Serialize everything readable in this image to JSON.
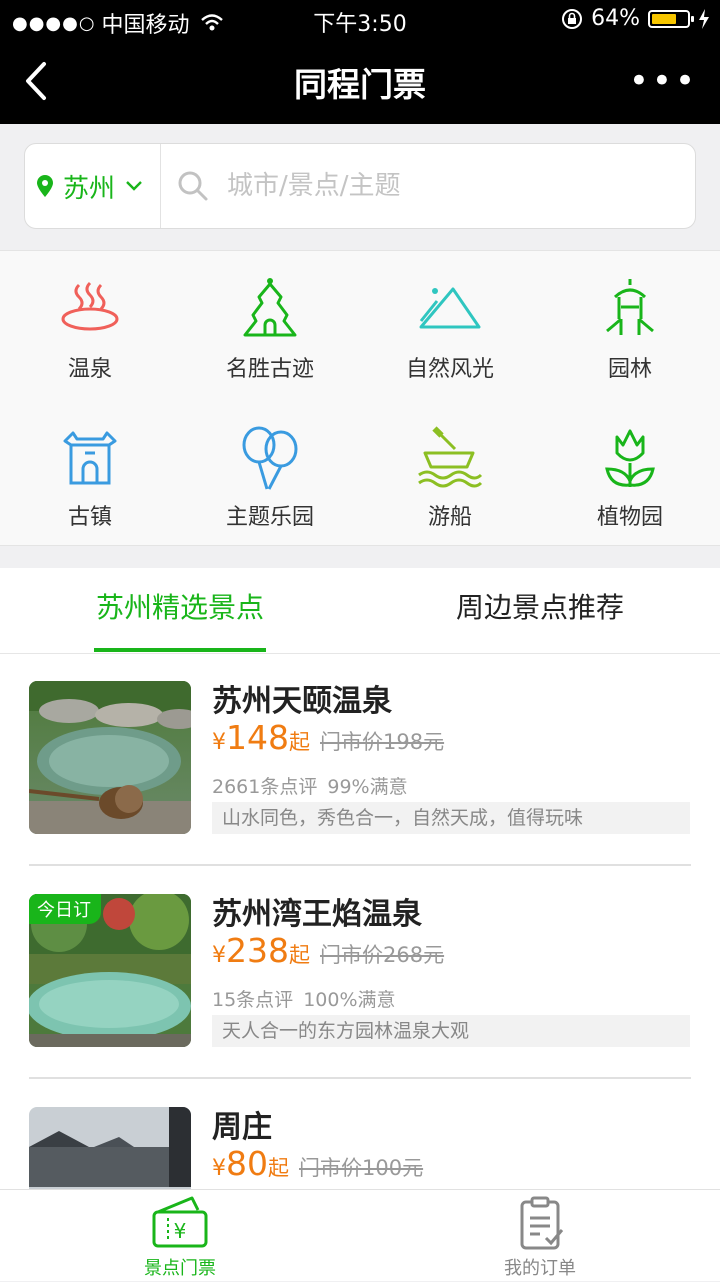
{
  "status_bar": {
    "signal": "●●●●○",
    "carrier": "中国移动",
    "time": "下午3:50",
    "battery": "64%",
    "battery_level": 0.64
  },
  "nav": {
    "title": "同程门票",
    "more": "•••"
  },
  "search": {
    "city": "苏州",
    "placeholder": "城市/景点/主题"
  },
  "categories": [
    {
      "label": "温泉",
      "icon": "hot-spring-icon",
      "color": "#f0605a"
    },
    {
      "label": "名胜古迹",
      "icon": "pagoda-icon",
      "color": "#19b51a"
    },
    {
      "label": "自然风光",
      "icon": "mountain-icon",
      "color": "#2fc6c0"
    },
    {
      "label": "园林",
      "icon": "pavilion-icon",
      "color": "#19b51a"
    },
    {
      "label": "古镇",
      "icon": "town-gate-icon",
      "color": "#3a9be0"
    },
    {
      "label": "主题乐园",
      "icon": "balloon-icon",
      "color": "#3a9be0"
    },
    {
      "label": "游船",
      "icon": "boat-icon",
      "color": "#8cbf23"
    },
    {
      "label": "植物园",
      "icon": "flower-icon",
      "color": "#19b51a"
    }
  ],
  "tabs": [
    {
      "label": "苏州精选景点",
      "active": true
    },
    {
      "label": "周边景点推荐",
      "active": false
    }
  ],
  "items": [
    {
      "name": "苏州天颐温泉",
      "yen": "¥",
      "price": "148",
      "qi": "起",
      "market": "门市价198元",
      "reviews": "2661条点评",
      "satisfaction": "99%满意",
      "desc": "山水同色，秀色合一，自然天成，值得玩味",
      "badge": ""
    },
    {
      "name": "苏州湾王焰温泉",
      "yen": "¥",
      "price": "238",
      "qi": "起",
      "market": "门市价268元",
      "reviews": "15条点评",
      "satisfaction": "100%满意",
      "desc": "天人合一的东方园林温泉大观",
      "badge": "今日订"
    },
    {
      "name": "周庄",
      "yen": "¥",
      "price": "80",
      "qi": "起",
      "market": "门市价100元",
      "reviews": "",
      "satisfaction": "",
      "desc": "",
      "badge": ""
    }
  ],
  "bottom_tabs": [
    {
      "label": "景点门票",
      "active": true,
      "icon": "ticket-icon"
    },
    {
      "label": "我的订单",
      "active": false,
      "icon": "order-icon"
    }
  ],
  "colors": {
    "accent": "#19b51a",
    "price": "#f07c12"
  }
}
